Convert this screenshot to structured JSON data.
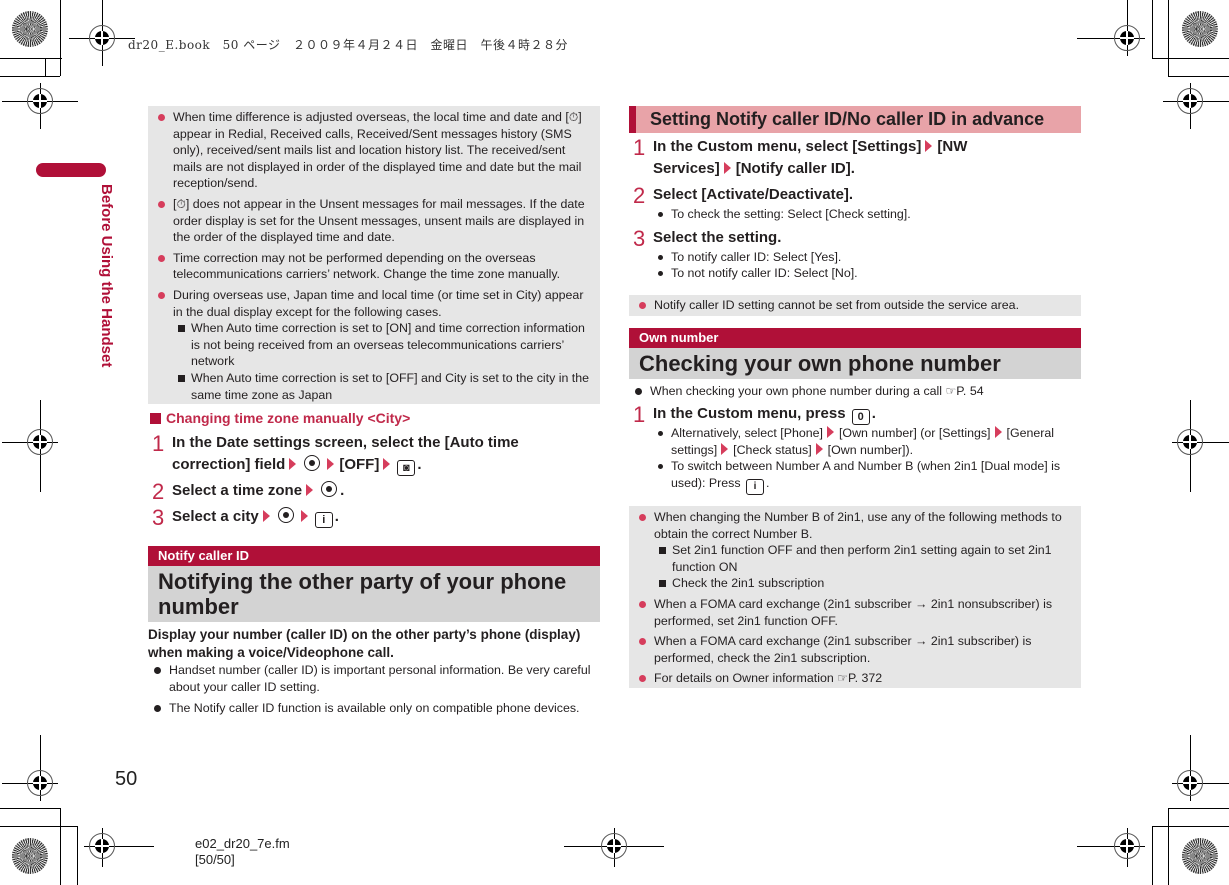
{
  "header": {
    "book_meta": "dr20_E.book　50 ページ　２００９年４月２４日　金曜日　午後４時２８分"
  },
  "sidebar": {
    "chapter_title": "Before Using the Handset"
  },
  "colors": {
    "accent_red": "#b01038",
    "bullet_pink": "#d63d5c",
    "note_grey": "#e6e6e6",
    "heading_pink": "#e8a3a8",
    "heading_grey": "#d3d3d3"
  },
  "left_column": {
    "notes": [
      {
        "icon": "clock-icon",
        "text_before": "When time difference is adjusted overseas, the local time and date and [",
        "text_after": "] appear in Redial, Received calls, Received/Sent messages history (SMS only), received/sent mails list and location history list. The received/sent mails are not displayed in order of the displayed time and date but the mail reception/send."
      },
      {
        "icon": "clock-icon",
        "text_before": "[",
        "text_after": "] does not appear in the Unsent messages for mail messages. If the date order display is set for the Unsent messages, unsent mails are displayed in the order of the displayed time and date."
      },
      {
        "text": "Time correction may not be performed depending on the overseas telecommunications carriers’ network. Change the time zone manually."
      },
      {
        "text": "During overseas use, Japan time and local time (or time set in City) appear in the dual display except for the following cases.",
        "sub": [
          "When Auto time correction is set to [ON] and time correction information is not being received from an overseas telecommunications carriers’ network",
          "When Auto time correction is set to [OFF] and City is set to the city in the same time zone as Japan"
        ]
      }
    ],
    "subsection_title": "Changing time zone manually <City>",
    "steps": [
      {
        "num": "1",
        "line1": "In the Date settings screen, select the [Auto time",
        "line2a": "correction] field",
        "line2b": "[OFF]",
        "end": "."
      },
      {
        "num": "2",
        "text": "Select a time zone",
        "end": "."
      },
      {
        "num": "3",
        "text": "Select a city",
        "end": "."
      }
    ],
    "section": {
      "label": "Notify caller ID",
      "title": "Notifying the other party of your phone number",
      "lead": "Display your number (caller ID) on the other party’s phone (display) when making a voice/Videophone call.",
      "bullets": [
        "Handset number (caller ID) is important personal information. Be very careful about your caller ID setting.",
        "The Notify caller ID function is available only on compatible phone devices."
      ]
    }
  },
  "right_column": {
    "advance_title": "Setting Notify caller ID/No caller ID in advance",
    "steps": [
      {
        "num": "1",
        "a": "In the Custom menu, select [Settings]",
        "b": "[NW",
        "c": "Services]",
        "d": "[Notify caller ID]."
      },
      {
        "num": "2",
        "text": "Select [Activate/Deactivate].",
        "subs": [
          "To check the setting: Select [Check setting]."
        ]
      },
      {
        "num": "3",
        "text": "Select the setting.",
        "subs": [
          "To notify caller ID: Select [Yes].",
          "To not notify caller ID: Select [No]."
        ]
      }
    ],
    "note_single": "Notify caller ID setting cannot be set from outside the service area.",
    "own": {
      "label": "Own number",
      "title": "Checking your own phone number",
      "lead_text": "When checking your own phone number during a call",
      "lead_ref": "P. 54",
      "step1_text": "In the Custom menu, press",
      "step1_key": "0",
      "sub1_a": "Alternatively, select [Phone]",
      "sub1_b": "[Own number] (or [Settings]",
      "sub1_c": "[General settings]",
      "sub1_d": "[Check status]",
      "sub1_e": "[Own number]).",
      "sub2_a": "To switch between Number A and Number B (when 2in1 [Dual mode] is used): Press",
      "key_i": "i"
    },
    "notes": [
      {
        "text": "When changing the Number B of 2in1, use any of the following methods to obtain the correct Number B.",
        "sub": [
          "Set 2in1 function OFF and then perform 2in1 setting again to set 2in1 function ON",
          "Check the 2in1 subscription"
        ]
      },
      {
        "text": "When a FOMA card exchange (2in1 subscriber → 2in1 nonsubscriber) is performed, set 2in1 function OFF."
      },
      {
        "text": "When a FOMA card exchange (2in1 subscriber → 2in1 subscriber) is performed, check the 2in1 subscription."
      },
      {
        "text": "For details on Owner information",
        "ref": "P. 372"
      }
    ]
  },
  "footer": {
    "page_number": "50",
    "file_name": "e02_dr20_7e.fm",
    "file_pages": "[50/50]"
  },
  "icons": {
    "ref": "☞",
    "clock_glyph": "⏱"
  }
}
